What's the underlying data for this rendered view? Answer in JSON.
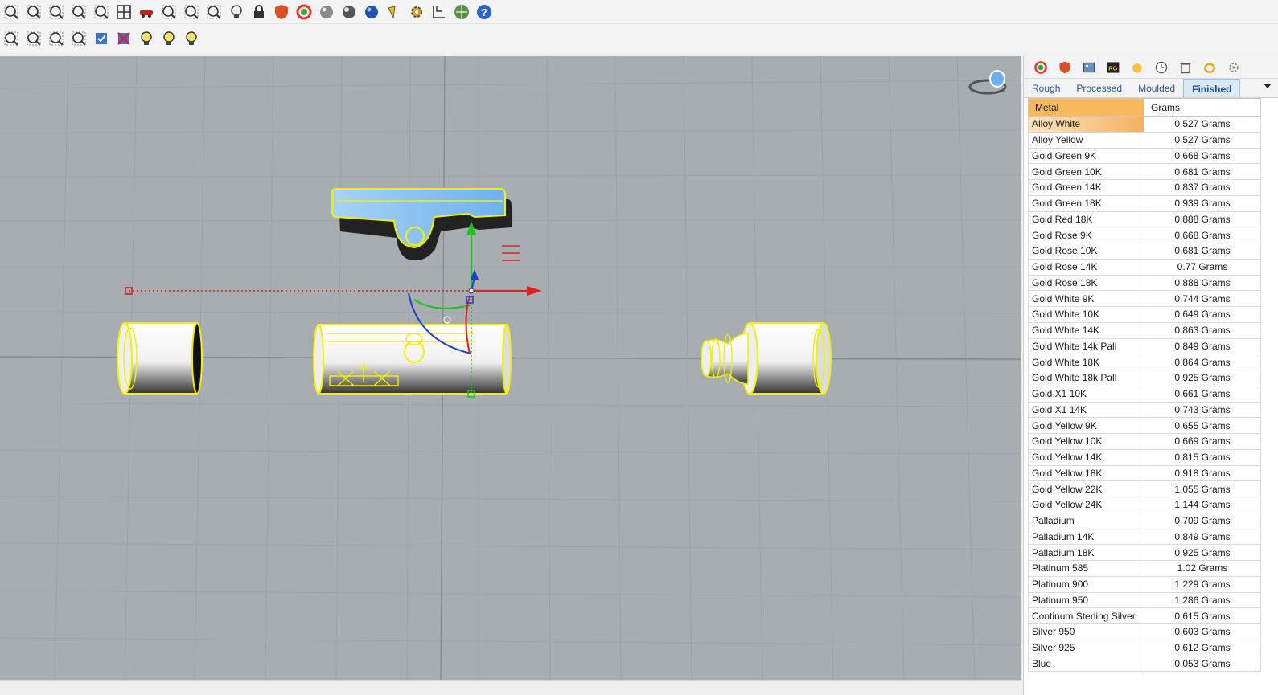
{
  "toolbar": {
    "row1_icons": [
      "zoom-window-icon",
      "zoom-extents-icon",
      "zoom-selected-icon",
      "zoom-icon",
      "undo-view-icon",
      "four-viewports-icon",
      "car-icon",
      "hand-icon",
      "circle-icon",
      "snap-icon",
      "light-bulb-icon",
      "lock-icon",
      "shield-icon",
      "color-wheel-icon",
      "gray-sphere-icon",
      "shaded-sphere-icon",
      "blue-sphere-icon",
      "gem-icon",
      "gear-icon",
      "dimension-icon",
      "globe-icon",
      "help-icon"
    ],
    "row2_icons": [
      "layer-copy-icon",
      "group-icon",
      "select-points-icon",
      "select-grid-icon",
      "show-icon",
      "hide-icon",
      "bulb-on-icon",
      "bulb-off-icon",
      "bulb-toggle-icon"
    ]
  },
  "panel": {
    "icons": [
      "color-wheel-icon",
      "shield-icon",
      "image-icon",
      "rg-icon",
      "gold-icon",
      "clock-icon",
      "trash-icon",
      "gold-ring-icon",
      "settings-icon"
    ],
    "tabs": [
      {
        "label": "Rough"
      },
      {
        "label": "Processed"
      },
      {
        "label": "Moulded"
      },
      {
        "label": "Finished"
      }
    ],
    "active_tab": "Finished",
    "table": {
      "headers": [
        "Metal",
        "Grams"
      ],
      "rows": [
        [
          "Alloy White",
          "0.527 Grams"
        ],
        [
          "Alloy Yellow",
          "0.527 Grams"
        ],
        [
          "Gold Green 9K",
          "0.668 Grams"
        ],
        [
          "Gold Green 10K",
          "0.681 Grams"
        ],
        [
          "Gold Green 14K",
          "0.837 Grams"
        ],
        [
          "Gold Green 18K",
          "0.939 Grams"
        ],
        [
          "Gold Red 18K",
          "0.888 Grams"
        ],
        [
          "Gold Rose 9K",
          "0.668 Grams"
        ],
        [
          "Gold Rose 10K",
          "0.681 Grams"
        ],
        [
          "Gold Rose 14K",
          "0.77 Grams"
        ],
        [
          "Gold Rose 18K",
          "0.888 Grams"
        ],
        [
          "Gold White 9K",
          "0.744 Grams"
        ],
        [
          "Gold White 10K",
          "0.649 Grams"
        ],
        [
          "Gold White 14K",
          "0.863 Grams"
        ],
        [
          "Gold White 14k Pall",
          "0.849 Grams"
        ],
        [
          "Gold White 18K",
          "0.864 Grams"
        ],
        [
          "Gold White 18k Pall",
          "0.925 Grams"
        ],
        [
          "Gold X1 10K",
          "0.661 Grams"
        ],
        [
          "Gold X1 14K",
          "0.743 Grams"
        ],
        [
          "Gold Yellow 9K",
          "0.655 Grams"
        ],
        [
          "Gold Yellow 10K",
          "0.669 Grams"
        ],
        [
          "Gold Yellow 14K",
          "0.815 Grams"
        ],
        [
          "Gold Yellow 18K",
          "0.918 Grams"
        ],
        [
          "Gold Yellow 22K",
          "1.055 Grams"
        ],
        [
          "Gold Yellow 24K",
          "1.144 Grams"
        ],
        [
          "Palladium",
          "0.709 Grams"
        ],
        [
          "Palladium 14K",
          "0.849 Grams"
        ],
        [
          "Palladium 18K",
          "0.925 Grams"
        ],
        [
          "Platinum 585",
          "1.02 Grams"
        ],
        [
          "Platinum 900",
          "1.229 Grams"
        ],
        [
          "Platinum 950",
          "1.286 Grams"
        ],
        [
          "Continum Sterling Silver",
          "0.615 Grams"
        ],
        [
          "Silver 950",
          "0.603 Grams"
        ],
        [
          "Silver 925",
          "0.612 Grams"
        ],
        [
          "Blue",
          "0.053 Grams"
        ]
      ],
      "selected_row": 0
    }
  },
  "colors": {
    "viewport_bg": "#a7adb1",
    "selection_yellow": "#f2f000",
    "header_orange": "#f6b85a",
    "active_tab_bg": "#dbe8f6"
  }
}
